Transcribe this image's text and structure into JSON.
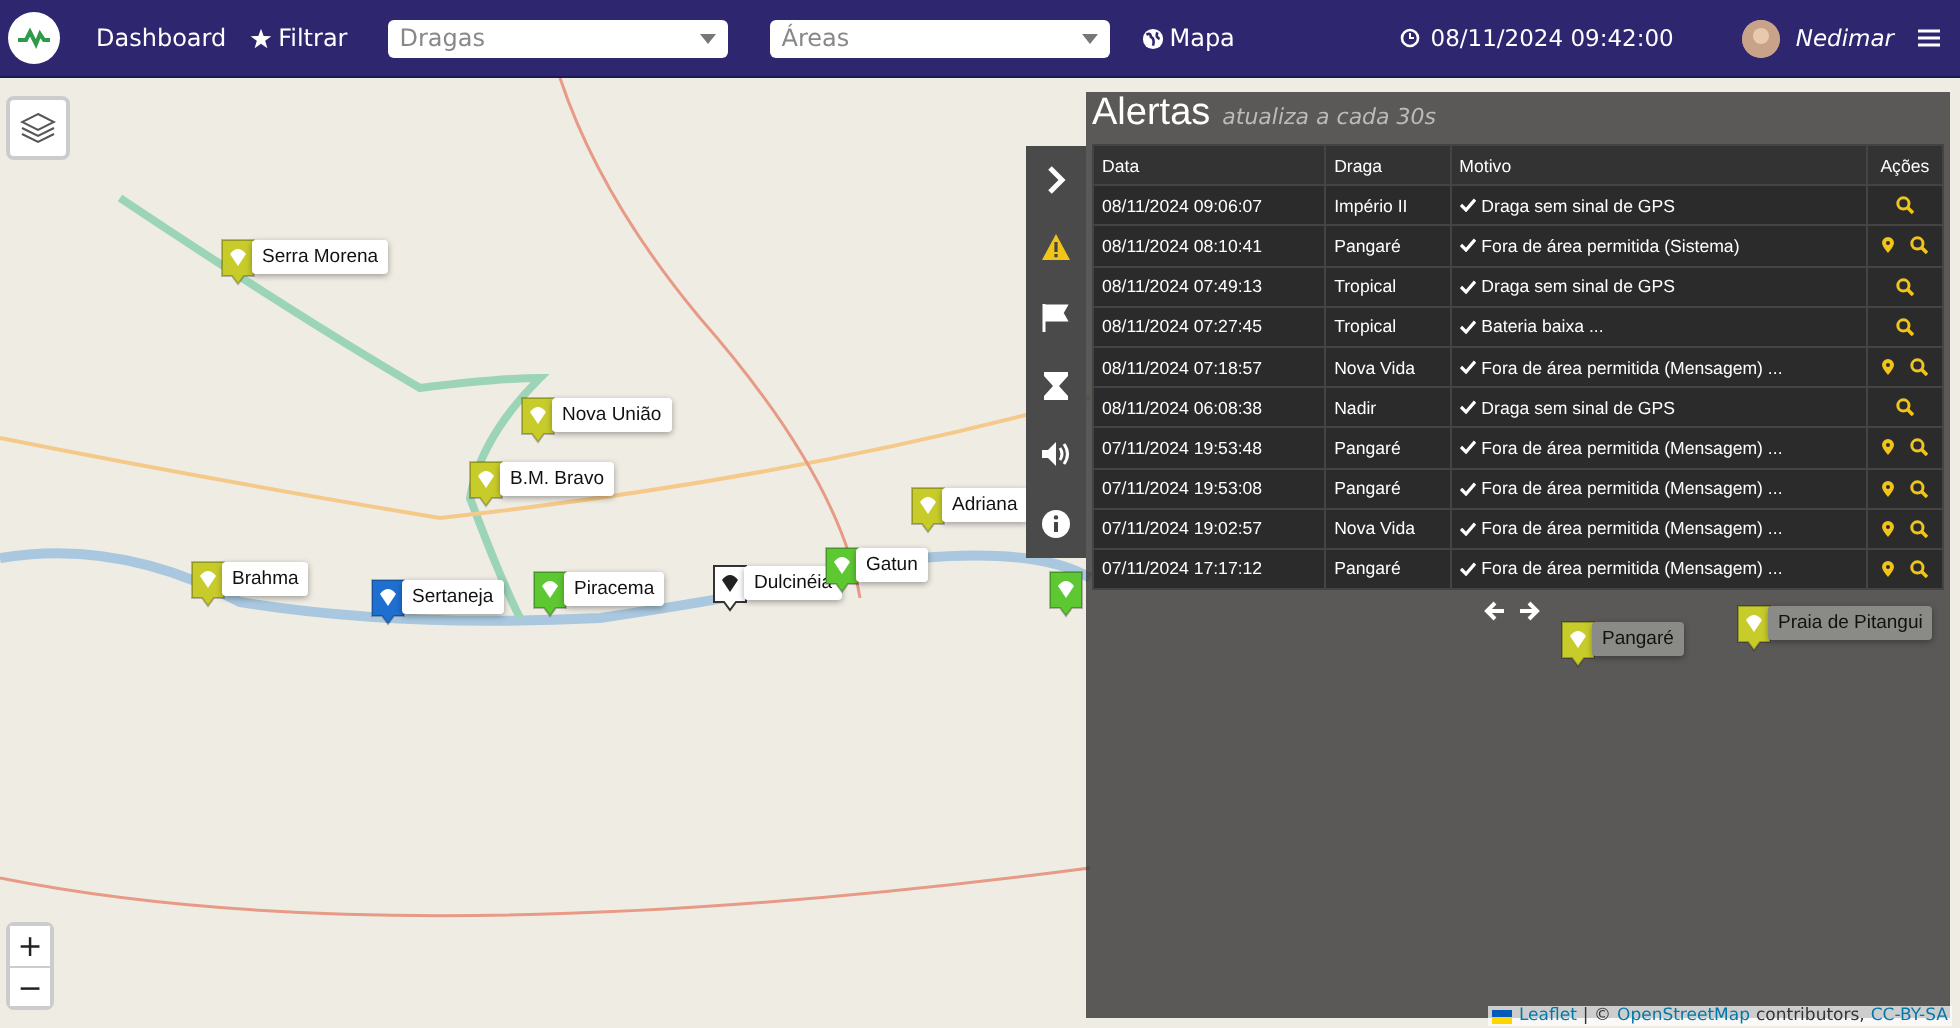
{
  "navbar": {
    "links": [
      {
        "kind": "plain",
        "label": "Dashboard"
      },
      {
        "kind": "star",
        "label": "Filtrar"
      }
    ],
    "selects": [
      {
        "placeholder": "Dragas"
      },
      {
        "placeholder": "Áreas"
      }
    ],
    "map_link": "Mapa",
    "clock": "08/11/2024 09:42:00",
    "user": "Nedimar"
  },
  "map": {
    "markers": [
      {
        "label": "Serra Morena",
        "color": "#c8cc2a"
      },
      {
        "label": "Nova União",
        "color": "#c8cc2a"
      },
      {
        "label": "B.M. Bravo",
        "color": "#c8cc2a"
      },
      {
        "label": "Brahma",
        "color": "#c8cc2a"
      },
      {
        "label": "Sertaneja",
        "color": "#1f6fd1"
      },
      {
        "label": "Piracema",
        "color": "#5ec832"
      },
      {
        "label": "Dulcinéia",
        "color": "#ffffff"
      },
      {
        "label": "Gatun",
        "color": "#5ec832"
      },
      {
        "label": "Adriana",
        "color": "#c8cc2a"
      },
      {
        "color": "#5ec832"
      }
    ],
    "dim_markers": [
      {
        "label": "Praia de Pitangui",
        "color": "#c8cc2a"
      },
      {
        "label": "Pangaré",
        "color": "#c8cc2a"
      }
    ],
    "zoom": [
      "+",
      "−"
    ],
    "attribution": {
      "leaflet": "Leaflet",
      "sep": "| ©",
      "osm": "OpenStreetMap",
      "contrib": "contributors,",
      "license": "CC-BY-SA"
    }
  },
  "toolbar": [
    {
      "kind": "chevron",
      "selected": false
    },
    {
      "kind": "warning",
      "selected": true
    },
    {
      "kind": "flag",
      "selected": false
    },
    {
      "kind": "hourglass",
      "selected": false
    },
    {
      "kind": "sound",
      "selected": false
    },
    {
      "kind": "info",
      "selected": false
    }
  ],
  "alerts": {
    "title": "Alertas",
    "subtitle": "atualiza a cada 30s",
    "columns": [
      "Data",
      "Draga",
      "Motivo",
      "Ações"
    ],
    "rows": [
      {
        "data": "08/11/2024 09:06:07",
        "draga": "Império II",
        "motivo": "Draga sem sinal de GPS",
        "location": false
      },
      {
        "data": "08/11/2024 08:10:41",
        "draga": "Pangaré",
        "motivo": "Fora de área permitida (Sistema)",
        "location": true
      },
      {
        "data": "08/11/2024 07:49:13",
        "draga": "Tropical",
        "motivo": "Draga sem sinal de GPS",
        "location": false
      },
      {
        "data": "08/11/2024 07:27:45",
        "draga": "Tropical",
        "motivo": "Bateria baixa ...",
        "location": false
      },
      {
        "data": "08/11/2024 07:18:57",
        "draga": "Nova Vida",
        "motivo": "Fora de área permitida (Mensagem) ...",
        "location": true
      },
      {
        "data": "08/11/2024 06:08:38",
        "draga": "Nadir",
        "motivo": "Draga sem sinal de GPS",
        "location": false
      },
      {
        "data": "07/11/2024 19:53:48",
        "draga": "Pangaré",
        "motivo": "Fora de área permitida (Mensagem) ...",
        "location": true
      },
      {
        "data": "07/11/2024 19:53:08",
        "draga": "Pangaré",
        "motivo": "Fora de área permitida (Mensagem) ...",
        "location": true
      },
      {
        "data": "07/11/2024 19:02:57",
        "draga": "Nova Vida",
        "motivo": "Fora de área permitida (Mensagem) ...",
        "location": true
      },
      {
        "data": "07/11/2024 17:17:12",
        "draga": "Pangaré",
        "motivo": "Fora de área permitida (Mensagem) ...",
        "location": true
      }
    ]
  }
}
